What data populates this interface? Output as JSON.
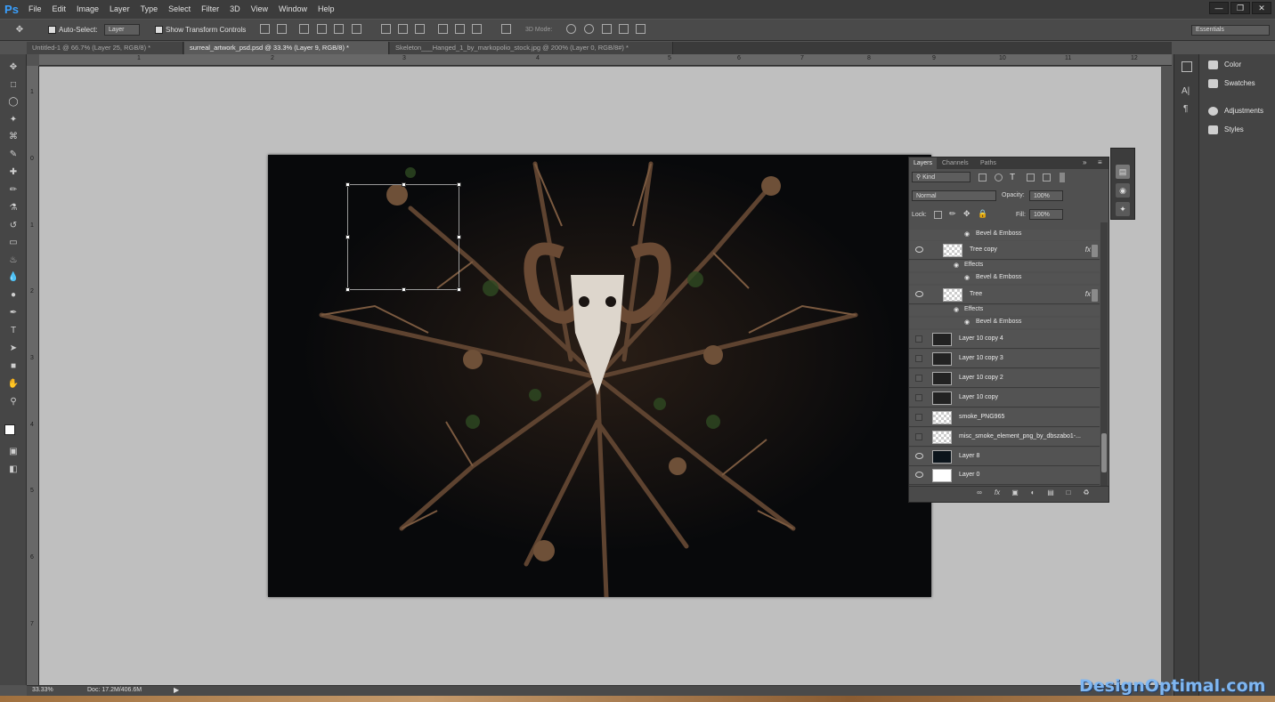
{
  "app": {
    "logo": "Ps"
  },
  "menubar": {
    "items": [
      "File",
      "Edit",
      "Image",
      "Layer",
      "Type",
      "Select",
      "Filter",
      "3D",
      "View",
      "Window",
      "Help"
    ]
  },
  "options": {
    "auto_select_label": "Auto-Select:",
    "auto_select_value": "Layer",
    "show_transform_label": "Show Transform Controls",
    "three_d_mode_label": "3D Mode:",
    "workspace": "Essentials"
  },
  "tabs": [
    {
      "label": "Untitled-1 @ 66.7% (Layer 25, RGB/8) *",
      "active": false
    },
    {
      "label": "surreal_artwork_psd.psd @ 33.3% (Layer 9, RGB/8) *",
      "active": true
    },
    {
      "label": "Skeleton___Hanged_1_by_markopolio_stock.jpg @ 200% (Layer 0, RGB/8#) *",
      "active": false
    }
  ],
  "ruler_top": [
    "1",
    "2",
    "3",
    "4",
    "5",
    "6",
    "7",
    "8",
    "9",
    "10",
    "11",
    "12"
  ],
  "ruler_left": [
    "1",
    "0",
    "1",
    "2",
    "3",
    "4",
    "5",
    "6",
    "7"
  ],
  "status": {
    "zoom": "33.33%",
    "doc": "Doc: 17.2M/406.6M"
  },
  "side_panels": [
    "Color",
    "Swatches",
    "Adjustments",
    "Styles"
  ],
  "layers_panel": {
    "tabs": [
      "Layers",
      "Channels",
      "Paths"
    ],
    "filter_kind": "Kind",
    "blend_mode": "Normal",
    "opacity_label": "Opacity:",
    "opacity_value": "100%",
    "lock_label": "Lock:",
    "fill_label": "Fill:",
    "fill_value": "100%",
    "top_effect": "Bevel & Emboss",
    "layers": [
      {
        "name": "Tree copy",
        "visible": true,
        "fx": "fx",
        "effects_label": "Effects",
        "effect": "Bevel & Emboss"
      },
      {
        "name": "Tree",
        "visible": true,
        "fx": "fx",
        "effects_label": "Effects",
        "effect": "Bevel & Emboss"
      },
      {
        "name": "Layer 10 copy 4",
        "visible": false
      },
      {
        "name": "Layer 10 copy 3",
        "visible": false
      },
      {
        "name": "Layer 10 copy 2",
        "visible": false
      },
      {
        "name": "Layer 10 copy",
        "visible": false
      },
      {
        "name": "smoke_PNG965",
        "visible": false
      },
      {
        "name": "misc_smoke_element_png_by_dbszabo1-...",
        "visible": false
      },
      {
        "name": "Layer 8",
        "visible": true
      },
      {
        "name": "Layer 0",
        "visible": true
      }
    ]
  },
  "watermark": "DesignOptimal.com",
  "colors": {
    "canvas_bg": "#08090b",
    "workspace_bg": "#bfbfbf",
    "ui_dark": "#3c3c3c",
    "accent": "#3aa0ff"
  }
}
